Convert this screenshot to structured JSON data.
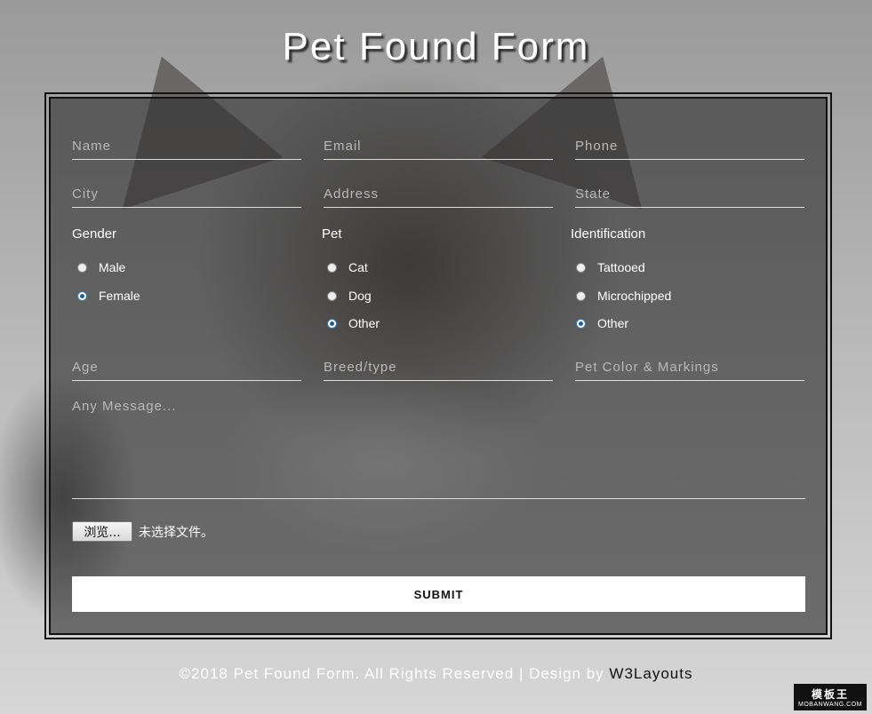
{
  "title": "Pet Found Form",
  "fields": {
    "name": "Name",
    "email": "Email",
    "phone": "Phone",
    "city": "City",
    "address": "Address",
    "state": "State",
    "age": "Age",
    "breed": "Breed/type",
    "color": "Pet Color & Markings",
    "message": "Any Message..."
  },
  "gender": {
    "label": "Gender",
    "options": [
      "Male",
      "Female"
    ],
    "selected": "Female"
  },
  "pet": {
    "label": "Pet",
    "options": [
      "Cat",
      "Dog",
      "Other"
    ],
    "selected": "Other"
  },
  "identification": {
    "label": "Identification",
    "options": [
      "Tattooed",
      "Microchipped",
      "Other"
    ],
    "selected": "Other"
  },
  "file": {
    "button": "浏览...",
    "status": "未选择文件。"
  },
  "submit": "SUBMIT",
  "footer": {
    "text": "©2018 Pet Found Form. All Rights Reserved | Design by ",
    "link": "W3Layouts"
  },
  "watermark": {
    "main": "模板王",
    "sub": "MOBANWANG.COM"
  }
}
